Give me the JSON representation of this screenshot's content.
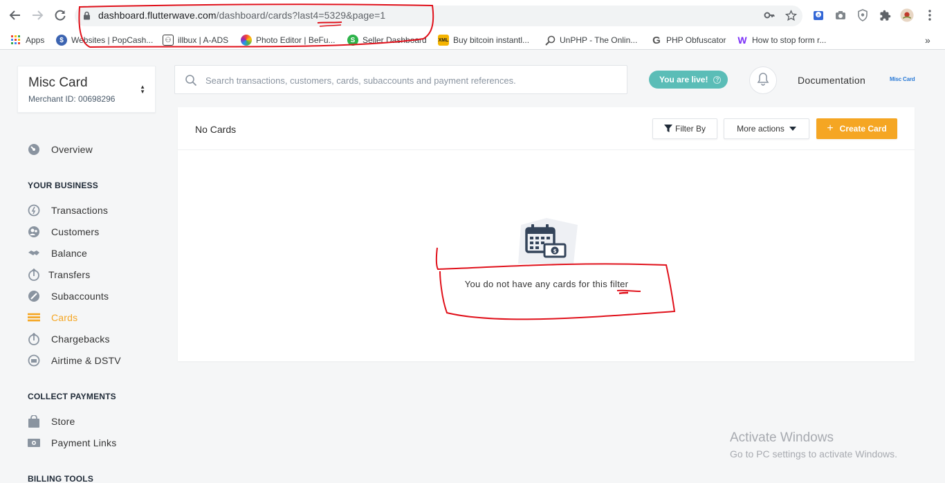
{
  "browser": {
    "url_host": "dashboard.flutterwave.com",
    "url_path": "/dashboard/cards?last4=5329&page=1",
    "bookmarks": [
      {
        "label": "Apps",
        "icon": "apps-grid-icon"
      },
      {
        "label": "Websites | PopCash...",
        "icon": "popcash-icon"
      },
      {
        "label": "illbux | A-ADS",
        "icon": "aads-icon"
      },
      {
        "label": "Photo Editor | BeFu...",
        "icon": "befunky-icon"
      },
      {
        "label": "Seller Dashboard",
        "icon": "seller-icon"
      },
      {
        "label": "Buy bitcoin instantl...",
        "icon": "xml-icon"
      },
      {
        "label": "UnPHP - The Onlin...",
        "icon": "magnifier-icon"
      },
      {
        "label": "PHP Obfuscator",
        "icon": "g-icon"
      },
      {
        "label": "How to stop form r...",
        "icon": "w-icon"
      }
    ],
    "more_bookmarks": "»"
  },
  "merchant": {
    "name": "Misc Card",
    "id_label": "Merchant ID: 00698296"
  },
  "sidebar": {
    "overview": "Overview",
    "section_business": "YOUR BUSINESS",
    "business_items": [
      "Transactions",
      "Customers",
      "Balance",
      "Transfers",
      "Subaccounts",
      "Cards",
      "Chargebacks",
      "Airtime & DSTV"
    ],
    "section_collect": "COLLECT PAYMENTS",
    "collect_items": [
      "Store",
      "Payment Links"
    ],
    "section_billing": "BILLING TOOLS",
    "active_item": "Cards"
  },
  "topbar": {
    "search_placeholder": "Search transactions, customers, cards, subaccounts and payment references.",
    "live_label": "You are live!",
    "docs_label": "Documentation",
    "brand_label": "Misc Card"
  },
  "panel": {
    "title": "No Cards",
    "filter_label": "Filter By",
    "more_actions_label": "More actions",
    "create_label": "Create Card",
    "empty_message": "You do not have any cards for this filter"
  },
  "watermark": {
    "line1": "Activate Windows",
    "line2": "Go to PC settings to activate Windows."
  },
  "colors": {
    "accent": "#f5a623",
    "live": "#5bbdb7",
    "annotation": "#e0101a"
  }
}
